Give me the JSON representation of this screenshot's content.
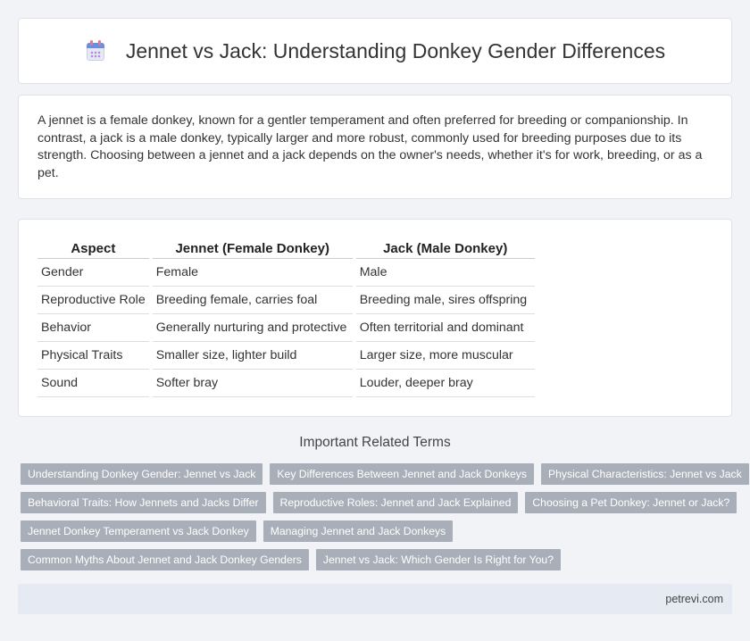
{
  "header": {
    "title": "Jennet vs Jack: Understanding Donkey Gender Differences",
    "icon": "calendar-icon"
  },
  "intro": {
    "text": "A jennet is a female donkey, known for a gentler temperament and often preferred for breeding or companionship. In contrast, a jack is a male donkey, typically larger and more robust, commonly used for breeding purposes due to its strength. Choosing between a jennet and a jack depends on the owner's needs, whether it's for work, breeding, or as a pet."
  },
  "table": {
    "headers": [
      "Aspect",
      "Jennet (Female Donkey)",
      "Jack (Male Donkey)"
    ],
    "rows": [
      [
        "Gender",
        "Female",
        "Male"
      ],
      [
        "Reproductive Role",
        "Breeding female, carries foal",
        "Breeding male, sires offspring"
      ],
      [
        "Behavior",
        "Generally nurturing and protective",
        "Often territorial and dominant"
      ],
      [
        "Physical Traits",
        "Smaller size, lighter build",
        "Larger size, more muscular"
      ],
      [
        "Sound",
        "Softer bray",
        "Louder, deeper bray"
      ]
    ]
  },
  "related": {
    "heading": "Important Related Terms",
    "rows": [
      [
        "Understanding Donkey Gender: Jennet vs Jack",
        "Key Differences Between Jennet and Jack Donkeys",
        "Physical Characteristics: Jennet vs Jack"
      ],
      [
        "Behavioral Traits: How Jennets and Jacks Differ",
        "Reproductive Roles: Jennet and Jack Explained",
        "Choosing a Pet Donkey: Jennet or Jack?"
      ],
      [
        "Jennet Donkey Temperament vs Jack Donkey",
        "Managing Jennet and Jack Donkeys"
      ],
      [
        "Common Myths About Jennet and Jack Donkey Genders",
        "Jennet vs Jack: Which Gender Is Right for You?"
      ]
    ]
  },
  "footer": {
    "site": "petrevi.com"
  }
}
